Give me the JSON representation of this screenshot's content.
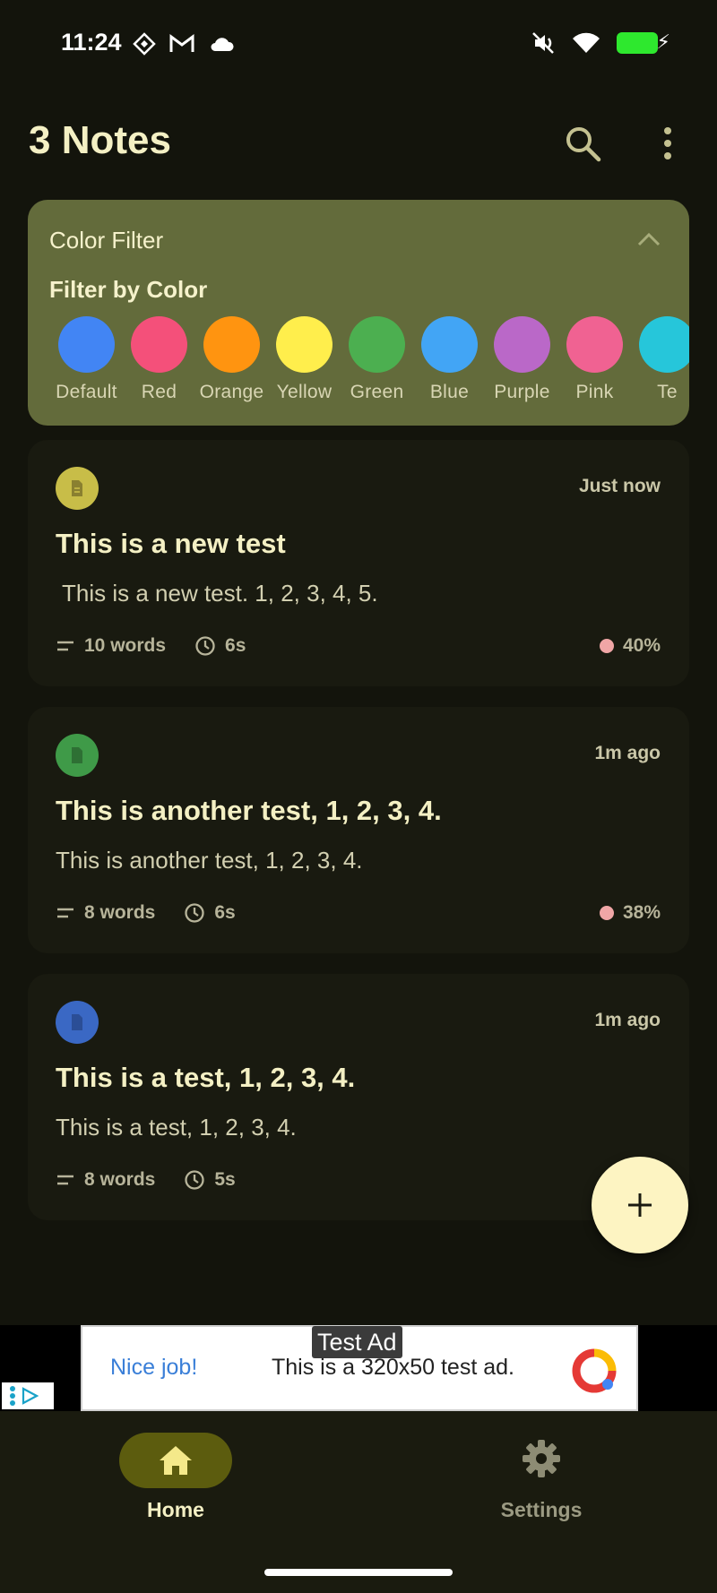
{
  "status_bar": {
    "time": "11:24"
  },
  "header": {
    "title": "3 Notes"
  },
  "color_filter": {
    "title": "Color Filter",
    "subtitle": "Filter by Color",
    "colors": [
      {
        "label": "Default",
        "color": "#4285f4"
      },
      {
        "label": "Red",
        "color": "#f4507a"
      },
      {
        "label": "Orange",
        "color": "#ff9410"
      },
      {
        "label": "Yellow",
        "color": "#ffee4c"
      },
      {
        "label": "Green",
        "color": "#4caf50"
      },
      {
        "label": "Blue",
        "color": "#42a5f5"
      },
      {
        "label": "Purple",
        "color": "#ba68c8"
      },
      {
        "label": "Pink",
        "color": "#f06292"
      },
      {
        "label": "Te",
        "color": "#26c6da"
      }
    ]
  },
  "notes": [
    {
      "title": "This is a new test",
      "body": "This is a new test. 1, 2, 3, 4, 5.",
      "time": "Just now",
      "words": "10 words",
      "read_time": "6s",
      "progress": "40%",
      "icon_color": "#c8bd48"
    },
    {
      "title": "This is another test, 1, 2, 3, 4.",
      "body": "This is another test, 1, 2, 3, 4.",
      "time": "1m ago",
      "words": "8 words",
      "read_time": "6s",
      "progress": "38%",
      "icon_color": "#3f9a48"
    },
    {
      "title": "This is a test, 1, 2, 3, 4.",
      "body": "This is a test, 1, 2, 3, 4.",
      "time": "1m ago",
      "words": "8 words",
      "read_time": "5s",
      "progress": "",
      "icon_color": "#3a68c4"
    }
  ],
  "ad": {
    "label": "Test Ad",
    "headline": "Nice job!",
    "text": "This is a 320x50 test ad."
  },
  "bottom_nav": {
    "home_label": "Home",
    "settings_label": "Settings"
  }
}
